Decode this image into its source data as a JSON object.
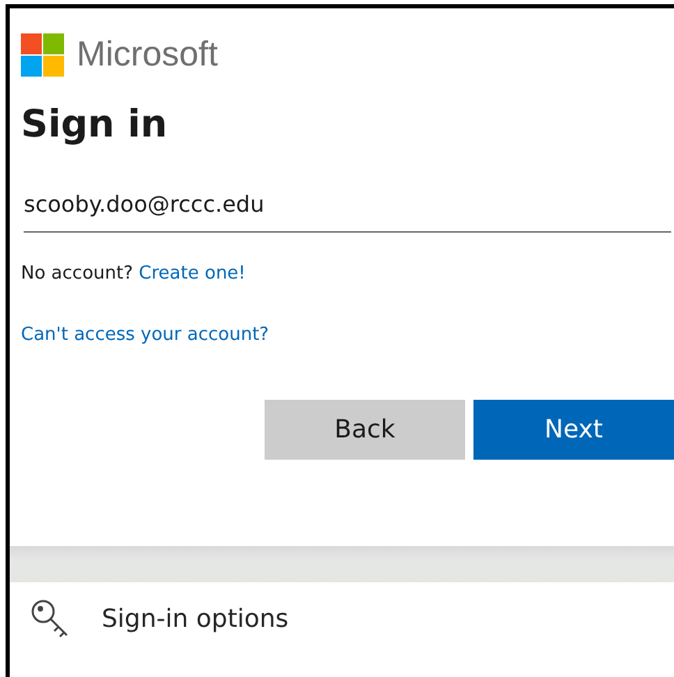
{
  "brand": {
    "name": "Microsoft"
  },
  "heading": "Sign in",
  "email_field": {
    "value": "scooby.doo@rccc.edu"
  },
  "no_account": {
    "text": "No account?",
    "link": "Create one!"
  },
  "access_link": "Can't access your account?",
  "buttons": [
    {
      "label": "Back",
      "kind": "secondary"
    },
    {
      "label": "Next",
      "kind": "primary"
    }
  ],
  "sign_in_options": {
    "label": "Sign-in options"
  }
}
